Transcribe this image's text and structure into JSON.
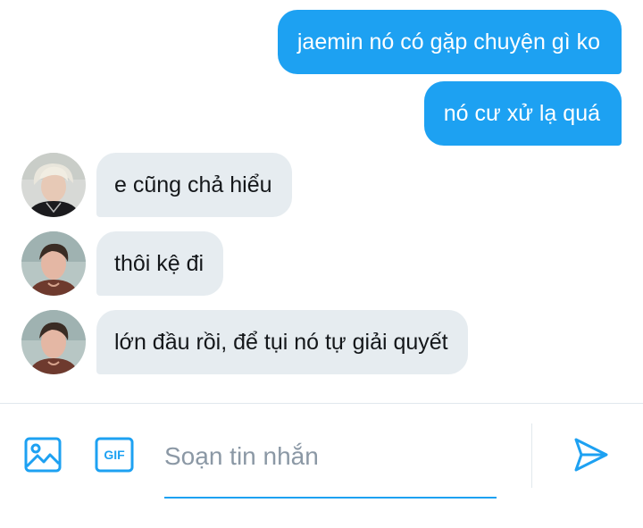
{
  "messages": [
    {
      "side": "out",
      "text": "jaemin nó có gặp chuyện gì ko"
    },
    {
      "side": "out",
      "text": "nó cư xử lạ quá"
    },
    {
      "side": "in",
      "text": "e cũng chả hiểu"
    },
    {
      "side": "in",
      "text": "thôi kệ đi"
    },
    {
      "side": "in",
      "text": "lớn đầu rồi, để tụi nó tự giải quyết"
    }
  ],
  "composer": {
    "placeholder": "Soạn tin nhắn",
    "value": "",
    "gif_label": "GIF"
  },
  "colors": {
    "accent": "#1da1f2",
    "incoming_bubble": "#e6ecf0",
    "outgoing_text": "#ffffff",
    "incoming_text": "#14171a"
  }
}
